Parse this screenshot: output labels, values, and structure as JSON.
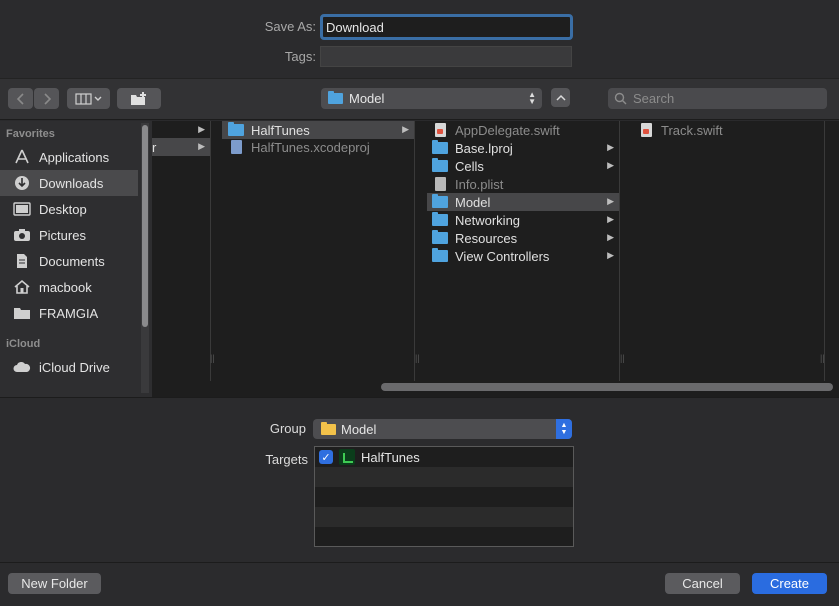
{
  "dialog": {
    "save_as_label": "Save As:",
    "save_as_value": "Download",
    "tags_label": "Tags:",
    "tags_value": ""
  },
  "toolbar": {
    "location_popup": "Model",
    "search_placeholder": "Search",
    "icons": [
      "chevron-left-icon",
      "chevron-right-icon",
      "column-view-icon",
      "new-folder-icon",
      "expand-icon"
    ]
  },
  "sidebar": {
    "favorites_header": "Favorites",
    "icloud_header": "iCloud",
    "items": [
      {
        "label": "Applications",
        "icon": "applications-icon"
      },
      {
        "label": "Downloads",
        "icon": "downloads-icon",
        "selected": true
      },
      {
        "label": "Desktop",
        "icon": "desktop-icon"
      },
      {
        "label": "Pictures",
        "icon": "camera-icon"
      },
      {
        "label": "Documents",
        "icon": "documents-icon"
      },
      {
        "label": "macbook",
        "icon": "home-icon"
      },
      {
        "label": "FRAMGIA",
        "icon": "folder-icon"
      }
    ],
    "icloud_items": [
      {
        "label": "iCloud Drive",
        "icon": "cloud-icon"
      }
    ]
  },
  "browser": {
    "col1": [
      {
        "label": "",
        "chevron": true
      },
      {
        "label": "r",
        "chevron": true,
        "selected": true
      }
    ],
    "col2": [
      {
        "label": "HalfTunes",
        "kind": "folder",
        "chevron": true,
        "selected": true
      },
      {
        "label": "HalfTunes.xcodeproj",
        "kind": "xcodeproj",
        "dim": true
      }
    ],
    "col3": [
      {
        "label": "AppDelegate.swift",
        "kind": "swift",
        "dim": true
      },
      {
        "label": "Base.lproj",
        "kind": "folder",
        "chevron": true
      },
      {
        "label": "Cells",
        "kind": "folder",
        "chevron": true
      },
      {
        "label": "Info.plist",
        "kind": "plist",
        "dim": true
      },
      {
        "label": "Model",
        "kind": "folder",
        "chevron": true,
        "selected": true
      },
      {
        "label": "Networking",
        "kind": "folder",
        "chevron": true
      },
      {
        "label": "Resources",
        "kind": "folder",
        "chevron": true
      },
      {
        "label": "View Controllers",
        "kind": "folder",
        "chevron": true
      }
    ],
    "col4": [
      {
        "label": "Track.swift",
        "kind": "swift",
        "dim": true
      }
    ]
  },
  "options": {
    "group_label": "Group",
    "group_value": "Model",
    "targets_label": "Targets",
    "targets": [
      {
        "label": "HalfTunes",
        "checked": true
      }
    ]
  },
  "buttons": {
    "new_folder": "New Folder",
    "cancel": "Cancel",
    "create": "Create"
  }
}
